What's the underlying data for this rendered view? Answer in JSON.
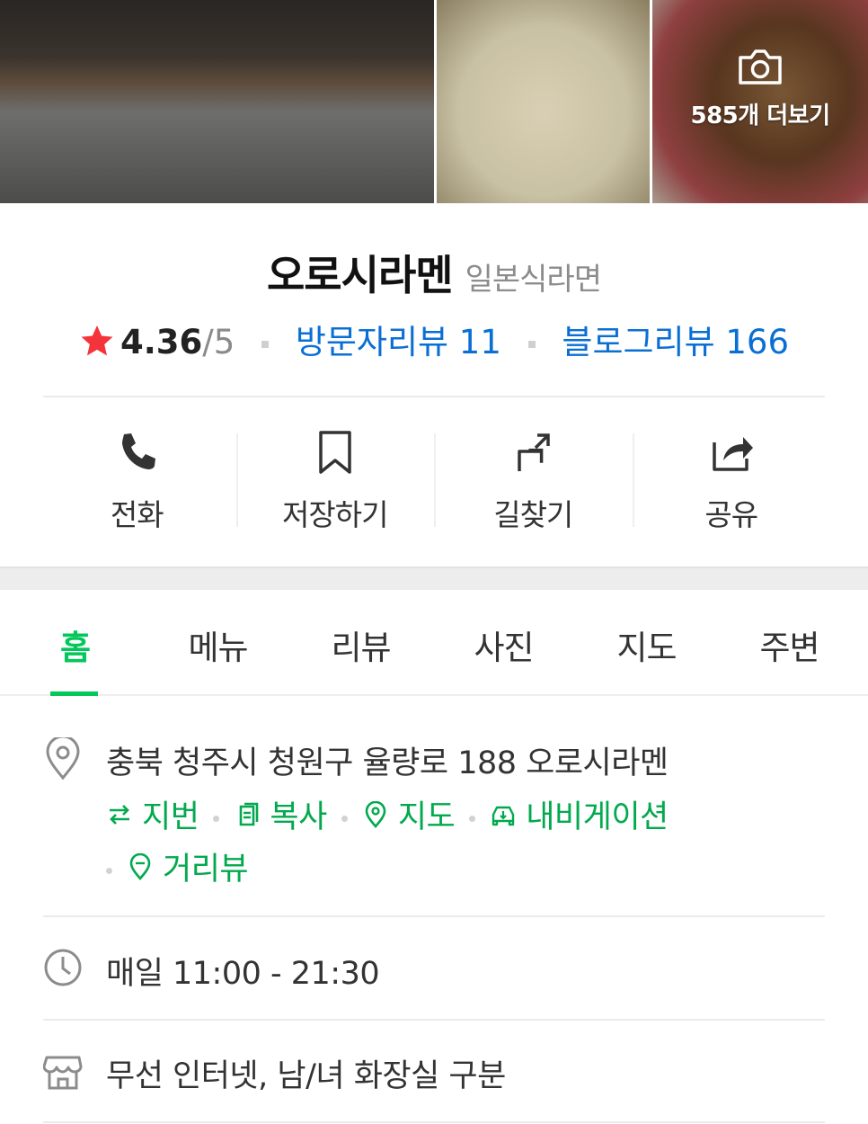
{
  "photos": {
    "more_label": "585개 더보기",
    "icon": "camera-icon"
  },
  "place": {
    "name": "오로시라멘",
    "category": "일본식라면"
  },
  "rating": {
    "score": "4.36",
    "total": "/5",
    "visitor_reviews": "방문자리뷰 11",
    "blog_reviews": "블로그리뷰 166"
  },
  "actions": [
    {
      "label": "전화",
      "icon": "phone-icon"
    },
    {
      "label": "저장하기",
      "icon": "bookmark-icon"
    },
    {
      "label": "길찾기",
      "icon": "directions-icon"
    },
    {
      "label": "공유",
      "icon": "share-icon"
    }
  ],
  "tabs": [
    {
      "label": "홈"
    },
    {
      "label": "메뉴"
    },
    {
      "label": "리뷰"
    },
    {
      "label": "사진"
    },
    {
      "label": "지도"
    },
    {
      "label": "주변"
    }
  ],
  "active_tab": "홈",
  "info": {
    "address": "충북 청주시 청원구 율량로 188 오로시라멘",
    "address_links": [
      {
        "label": "지번",
        "icon": "swap-icon"
      },
      {
        "label": "복사",
        "icon": "copy-icon"
      },
      {
        "label": "지도",
        "icon": "map-pin-icon"
      },
      {
        "label": "내비게이션",
        "icon": "car-icon"
      },
      {
        "label": "거리뷰",
        "icon": "street-view-icon"
      }
    ],
    "hours": "매일 11:00 - 21:30",
    "amenities": "무선 인터넷, 남/녀 화장실 구분"
  },
  "colors": {
    "accent_green": "#03c75a",
    "link_blue": "#0a6fd4",
    "star_red": "#f4333a"
  }
}
